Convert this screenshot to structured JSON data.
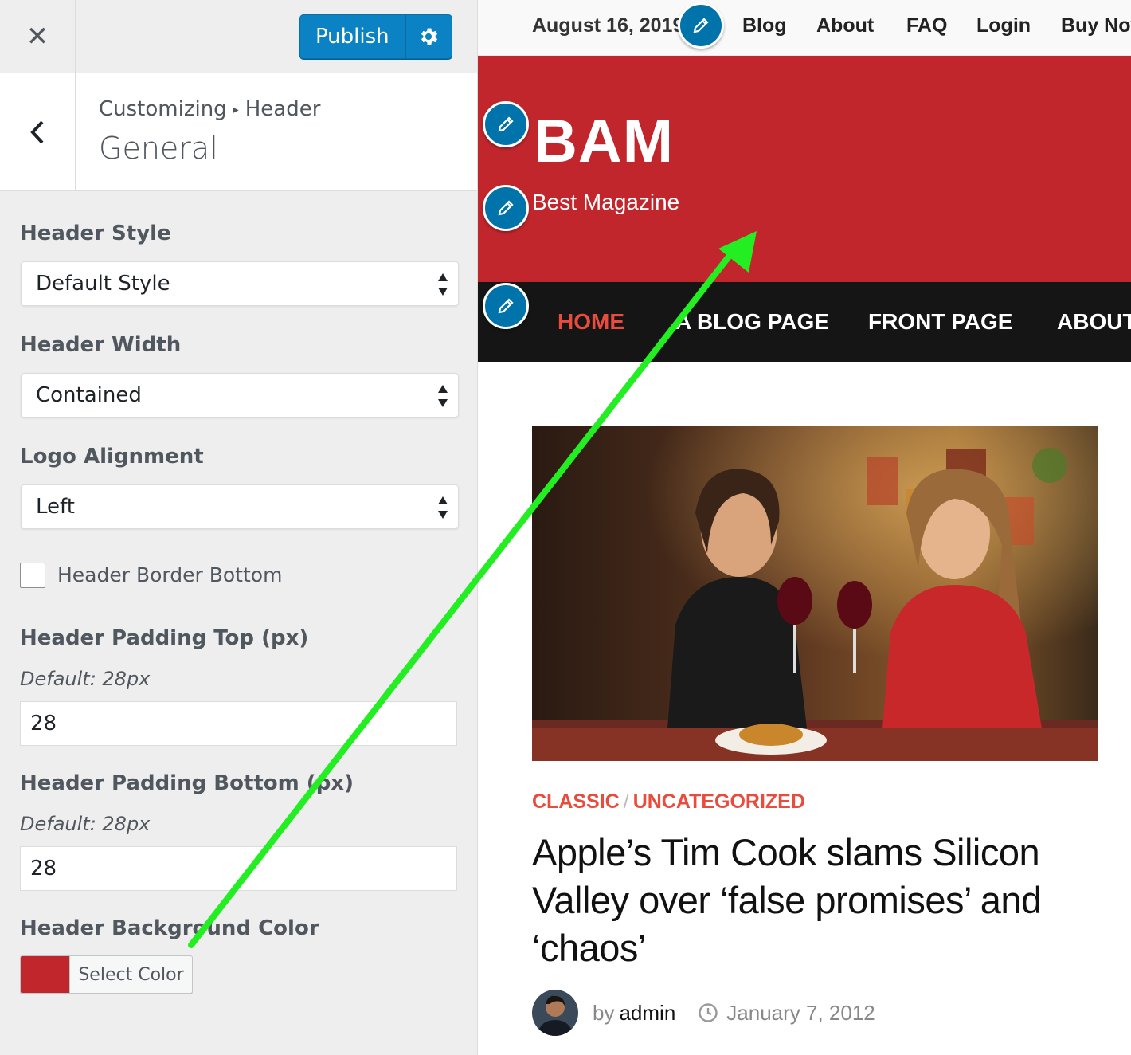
{
  "customizer": {
    "publish_label": "Publish",
    "breadcrumb": {
      "root": "Customizing",
      "separator": "▸",
      "section": "Header"
    },
    "section_title": "General",
    "controls": {
      "header_style": {
        "label": "Header Style",
        "value": "Default Style"
      },
      "header_width": {
        "label": "Header Width",
        "value": "Contained"
      },
      "logo_alignment": {
        "label": "Logo Alignment",
        "value": "Left"
      },
      "header_border_bottom": {
        "label": "Header Border Bottom",
        "checked": false
      },
      "padding_top": {
        "label": "Header Padding Top (px)",
        "description": "Default: 28px",
        "value": "28"
      },
      "padding_bottom": {
        "label": "Header Padding Bottom (px)",
        "description": "Default: 28px",
        "value": "28"
      },
      "background_color": {
        "label": "Header Background Color",
        "button_label": "Select Color",
        "value": "#c0262c"
      }
    }
  },
  "preview": {
    "top_bar": {
      "date": "August 16, 2019",
      "links": [
        "Blog",
        "About",
        "FAQ",
        "Login",
        "Buy Now"
      ]
    },
    "site_title": "BAM",
    "tagline": "Best Magazine",
    "main_nav": [
      "HOME",
      "A BLOG PAGE",
      "FRONT PAGE",
      "ABOUT"
    ],
    "post": {
      "categories": [
        "CLASSIC",
        "UNCATEGORIZED"
      ],
      "category_separator": "/",
      "title": "Apple’s Tim Cook slams Silicon Valley over ‘false promises’ and ‘chaos’",
      "by": "by",
      "author": "admin",
      "date": "January 7, 2012"
    }
  },
  "colors": {
    "header_bg": "#c0262c",
    "nav_bg": "#151515",
    "accent": "#e84c3d",
    "publish_button": "#0a82c4",
    "annotation_arrow": "#22ee22"
  }
}
